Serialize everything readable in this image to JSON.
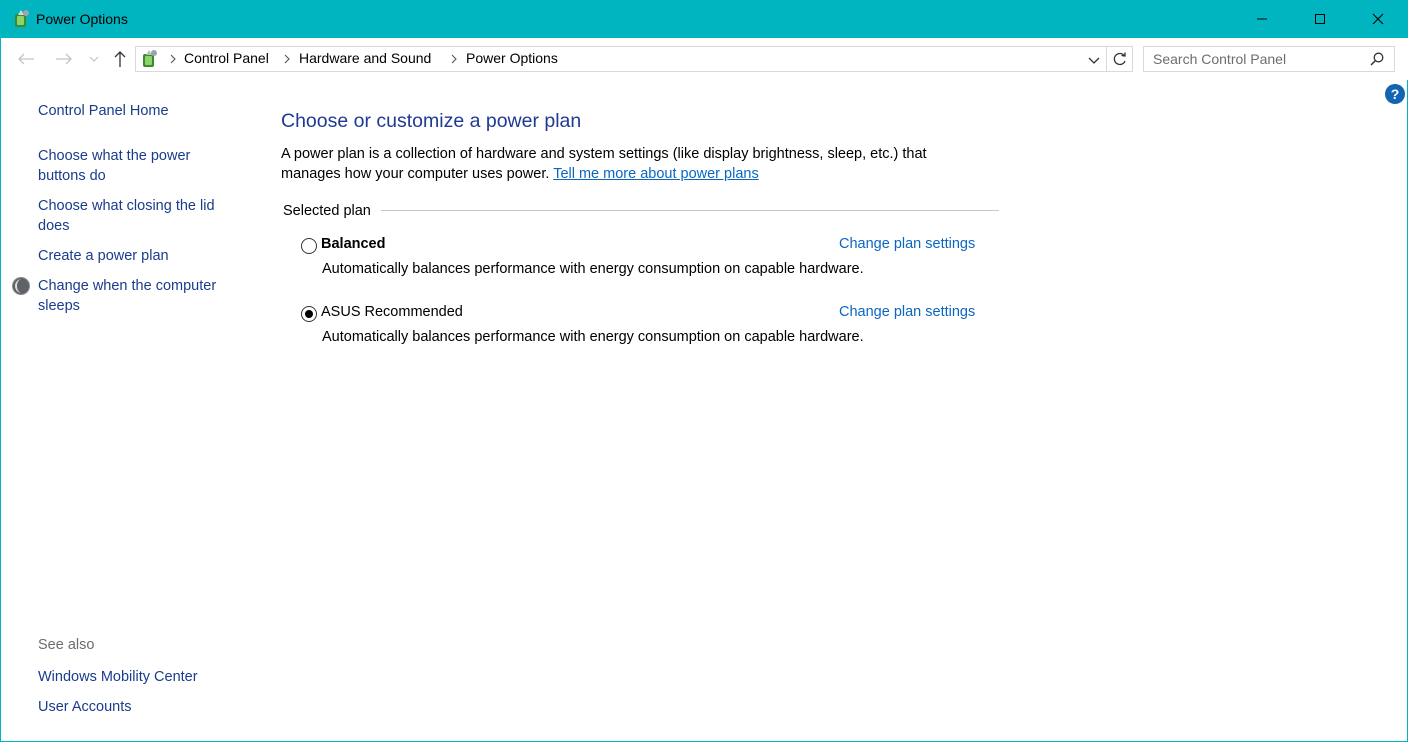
{
  "window": {
    "title": "Power Options",
    "accent_color": "#00b4c0",
    "controls": {
      "minimize_icon": "minimize-icon",
      "maximize_icon": "maximize-icon",
      "close_icon": "close-icon"
    }
  },
  "navigation": {
    "breadcrumb": [
      "Control Panel",
      "Hardware and Sound",
      "Power Options"
    ],
    "search_placeholder": "Search Control Panel"
  },
  "sidebar": {
    "home": "Control Panel Home",
    "links": [
      "Choose what the power buttons do",
      "Choose what closing the lid does",
      "Create a power plan",
      "Change when the computer sleeps"
    ],
    "see_also_label": "See also",
    "see_also_links": [
      "Windows Mobility Center",
      "User Accounts"
    ]
  },
  "main": {
    "heading": "Choose or customize a power plan",
    "description": "A power plan is a collection of hardware and system settings (like display brightness, sleep, etc.) that manages how your computer uses power.",
    "learn_more_link": "Tell me more about power plans",
    "group_label": "Selected plan",
    "plans": [
      {
        "name": "Balanced",
        "selected": false,
        "description": "Automatically balances performance with energy consumption on capable hardware.",
        "link": "Change plan settings"
      },
      {
        "name": "ASUS Recommended",
        "selected": true,
        "description": "Automatically balances performance with energy consumption on capable hardware.",
        "link": "Change plan settings"
      }
    ]
  },
  "help_label": "?",
  "colors": {
    "link": "#0b66c2",
    "heading": "#1e3a96",
    "sidebar_link": "#1a3c8c",
    "muted": "#6d6d6d"
  }
}
